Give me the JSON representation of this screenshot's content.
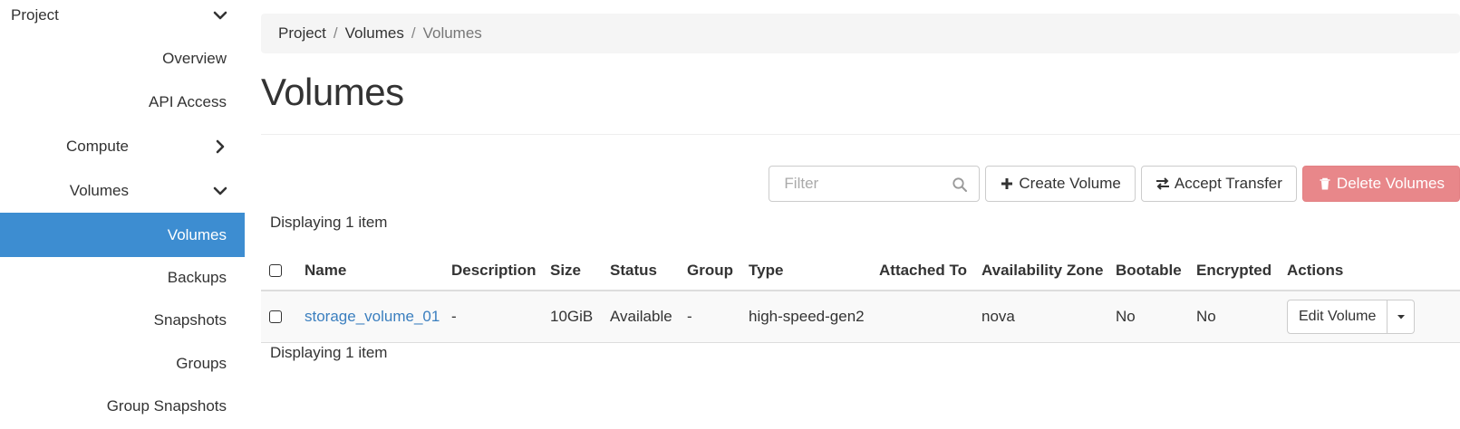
{
  "sidebar": {
    "project_label": "Project",
    "overview": "Overview",
    "api_access": "API Access",
    "compute": "Compute",
    "volumes_group": "Volumes",
    "items": [
      "Volumes",
      "Backups",
      "Snapshots",
      "Groups",
      "Group Snapshots"
    ],
    "active_item": "Volumes"
  },
  "breadcrumb": {
    "items": [
      "Project",
      "Volumes",
      "Volumes"
    ],
    "separator": "/"
  },
  "page": {
    "title": "Volumes"
  },
  "toolbar": {
    "filter_placeholder": "Filter",
    "filter_value": "",
    "create_label": "Create Volume",
    "accept_label": "Accept Transfer",
    "delete_label": "Delete Volumes"
  },
  "table": {
    "count_text": "Displaying 1 item",
    "headers": {
      "name": "Name",
      "description": "Description",
      "size": "Size",
      "status": "Status",
      "group": "Group",
      "type": "Type",
      "attached_to": "Attached To",
      "availability_zone": "Availability Zone",
      "bootable": "Bootable",
      "encrypted": "Encrypted",
      "actions": "Actions"
    },
    "rows": [
      {
        "name": "storage_volume_01",
        "description": "-",
        "size": "10GiB",
        "status": "Available",
        "group": "-",
        "type": "high-speed-gen2",
        "attached_to": "",
        "availability_zone": "nova",
        "bootable": "No",
        "encrypted": "No",
        "action_label": "Edit Volume"
      }
    ]
  },
  "colors": {
    "active_sidebar": "#3d8dd1",
    "link": "#3b7fbf",
    "danger_button": "#e8878a"
  },
  "icons": {
    "expand": "chevron-down-icon",
    "collapsed": "chevron-right-icon",
    "search": "search-icon",
    "create": "plus-icon",
    "transfer": "exchange-icon",
    "delete": "trash-icon",
    "dropdown": "caret-down-icon"
  }
}
